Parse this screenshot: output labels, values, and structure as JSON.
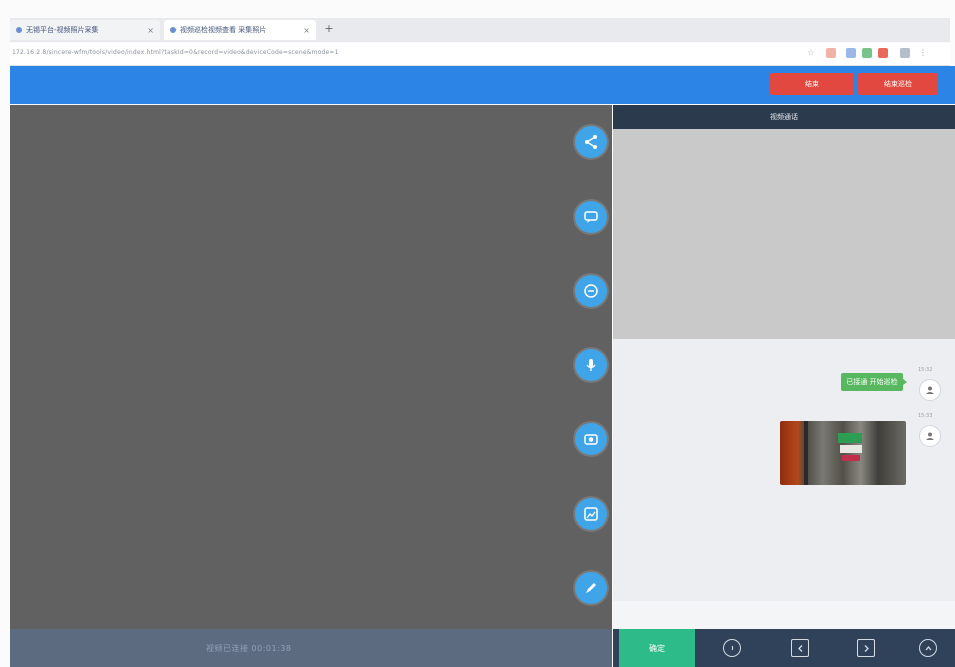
{
  "browser": {
    "tabs": [
      {
        "label": "无锡平台-视频照片采集"
      },
      {
        "label": "视频巡检视频查看 采集照片"
      }
    ],
    "url": "172.16.2.8/sincere-wfm/tools/video/index.html?taskId=0&record=video&deviceCode=scene&mode=1"
  },
  "header": {
    "buttons": [
      {
        "label": "结束"
      },
      {
        "label": "结束巡检"
      }
    ]
  },
  "video": {
    "side_icons": [
      "share-icon",
      "chat-icon",
      "message-icon",
      "microphone-icon",
      "camera-icon",
      "photo-capture-icon",
      "pen-icon"
    ]
  },
  "right_panel": {
    "title": "视频通话",
    "messages": [
      {
        "time": "15:32",
        "text": "已接通 开始巡检",
        "type": "text"
      },
      {
        "time": "15:33",
        "type": "image"
      }
    ]
  },
  "bottom": {
    "caption": "视频已连接 00:01:38",
    "confirm_label": "确定"
  },
  "colors": {
    "header_blue": "#2c84e6",
    "danger_red": "#e2483f",
    "icon_blue": "#3fa4e8",
    "confirm_green": "#2dbb8a",
    "bubble_green": "#58b85f"
  }
}
